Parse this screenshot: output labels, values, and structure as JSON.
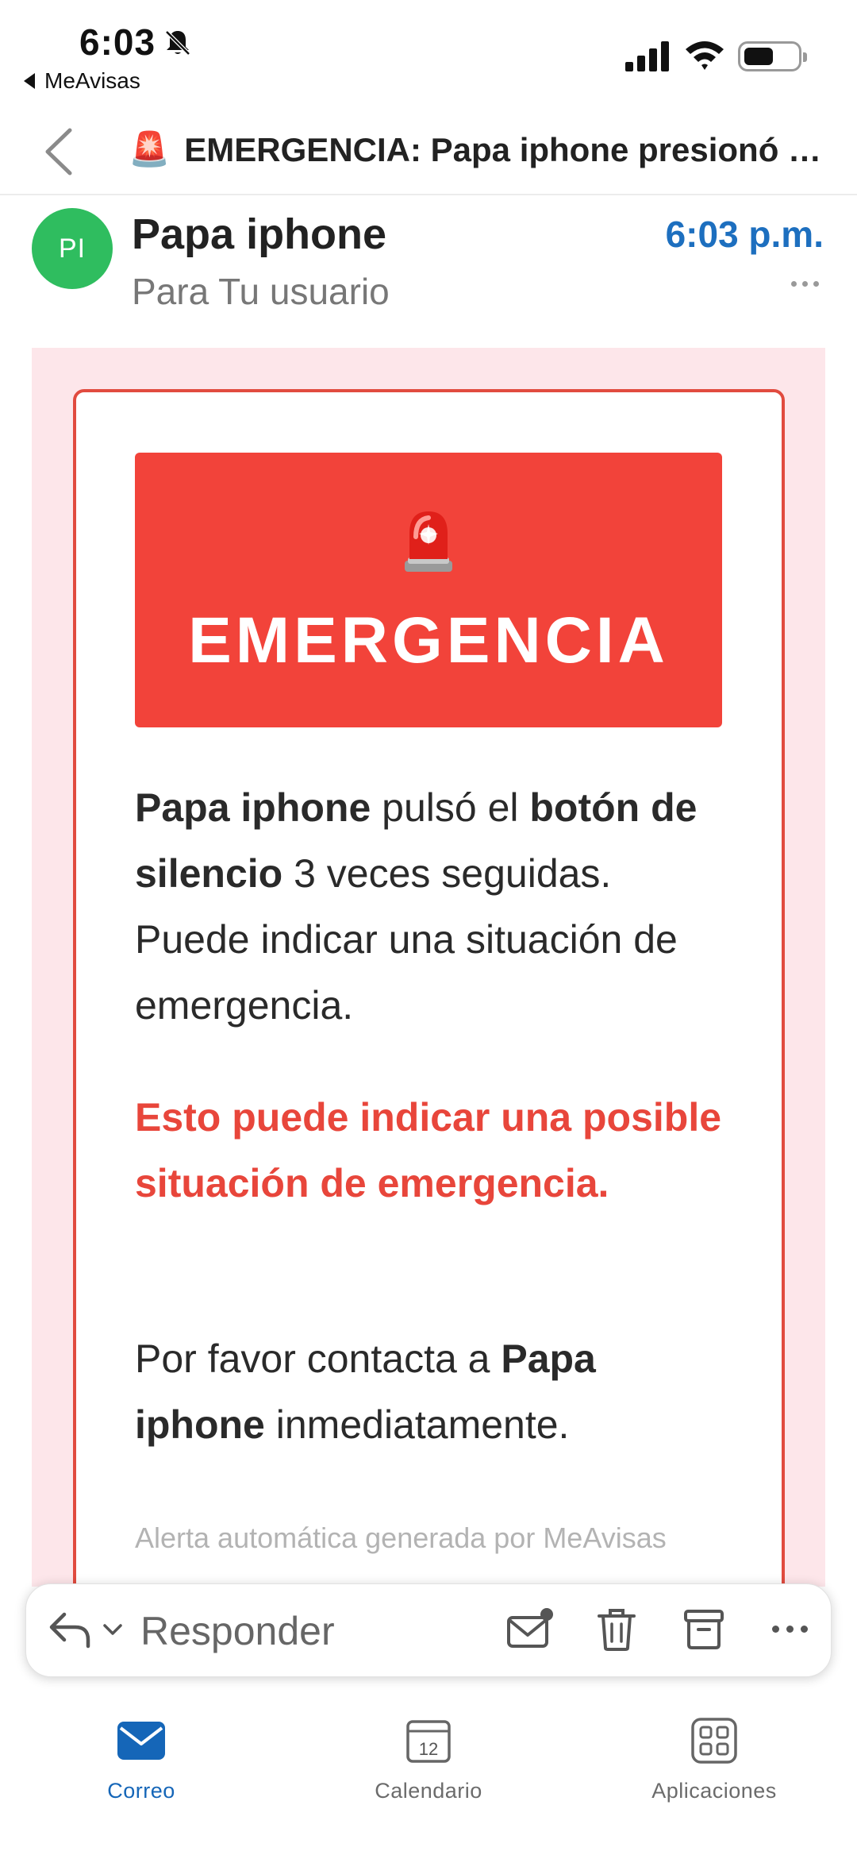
{
  "status_bar": {
    "time": "6:03",
    "back_app": "MeAvisas"
  },
  "header": {
    "title_emoji": "🚨",
    "title": "EMERGENCIA: Papa iphone presionó el botón de silencio"
  },
  "message": {
    "avatar_initials": "PI",
    "sender": "Papa iphone",
    "recipient": "Para Tu usuario",
    "time": "6:03 p.m."
  },
  "body": {
    "banner_text": "EMERGENCIA",
    "p1": {
      "name": "Papa iphone",
      "t1": " pulsó el ",
      "button": "botón de silencio",
      "t2": " 3 veces seguidas. Puede indicar una situación de emergencia."
    },
    "warning": "Esto puede indicar una posible situación de emergencia.",
    "p3": {
      "t1": "Por favor contacta a ",
      "name": "Papa iphone",
      "t2": " inmediatamente."
    },
    "footer_note": "Alerta automática generada por MeAvisas"
  },
  "reply_bar": {
    "reply_label": "Responder"
  },
  "bottom_nav": {
    "items": [
      {
        "label": "Correo",
        "icon": "mail-icon",
        "active": true
      },
      {
        "label": "Calendario",
        "icon": "calendar-icon",
        "active": false,
        "day": "12"
      },
      {
        "label": "Aplicaciones",
        "icon": "apps-icon",
        "active": false
      }
    ]
  },
  "colors": {
    "accent_blue": "#1566b8",
    "emergency_red": "#f2433a",
    "avatar_green": "#2fbd5f",
    "frame_pink": "#fde6ea"
  }
}
